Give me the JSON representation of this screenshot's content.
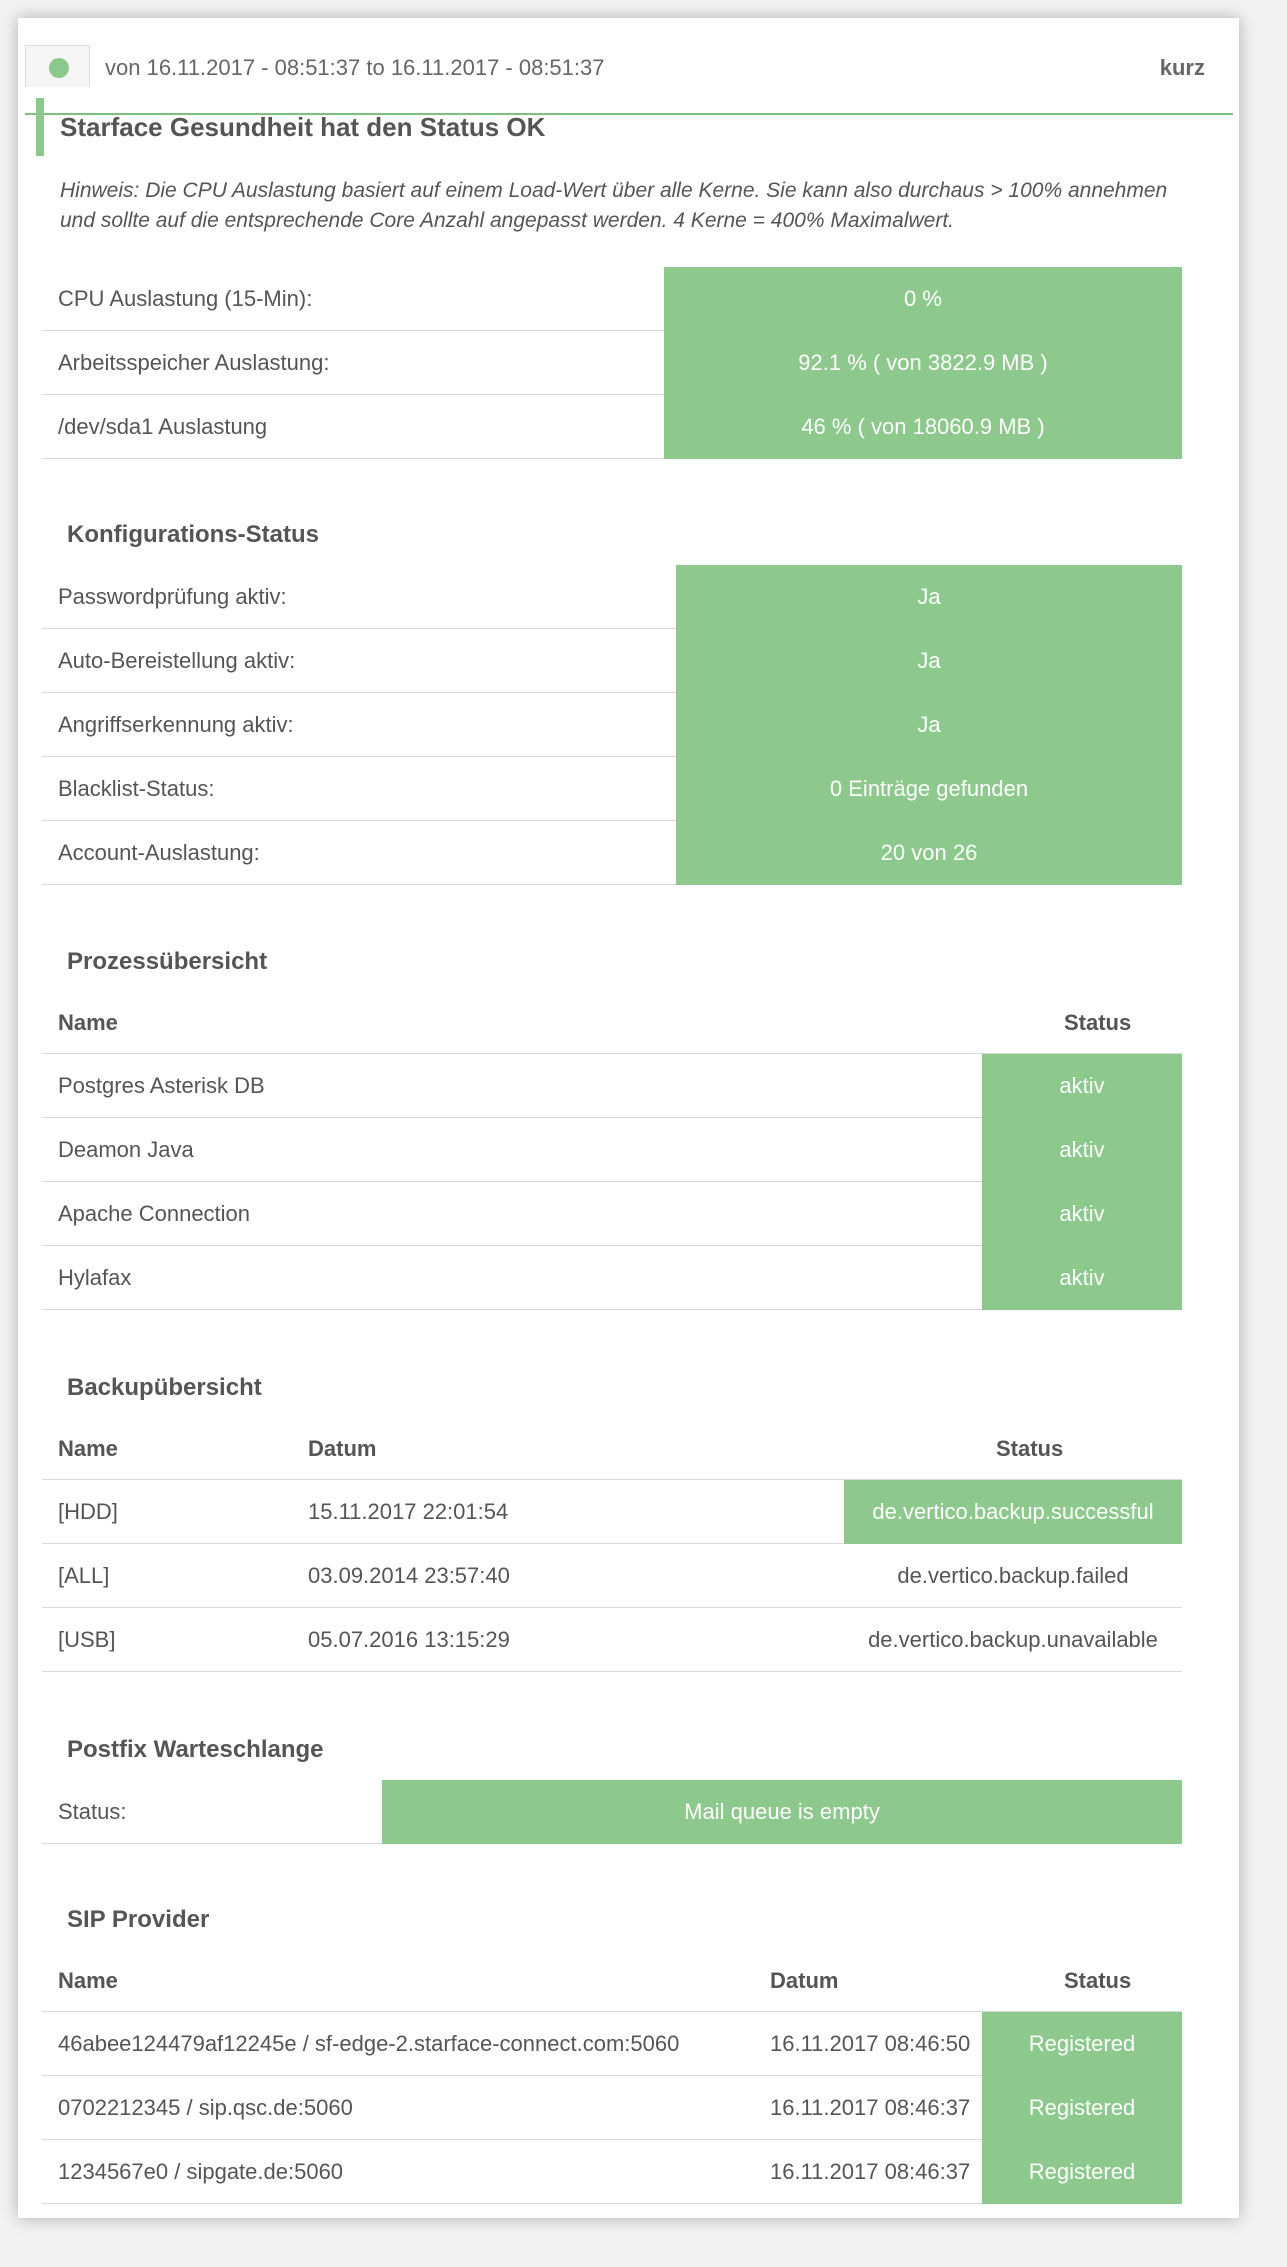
{
  "header": {
    "range": "von 16.11.2017 - 08:51:37 to 16.11.2017 - 08:51:37",
    "mode": "kurz",
    "status_color": "#8cc88c"
  },
  "health": {
    "title": "Starface Gesundheit hat den Status OK",
    "hint": "Hinweis: Die CPU Auslastung basiert auf einem Load-Wert über alle Kerne. Sie kann also durchaus > 100% annehmen und sollte auf die entsprechende Core Anzahl angepasst werden. 4 Kerne = 400% Maximalwert.",
    "rows": [
      {
        "label": "CPU Auslastung (15-Min):",
        "value": "0 %"
      },
      {
        "label": "Arbeitsspeicher Auslastung:",
        "value": "92.1 % ( von 3822.9 MB )"
      },
      {
        "label": "/dev/sda1 Auslastung",
        "value": "46 % ( von 18060.9 MB )"
      }
    ]
  },
  "config": {
    "title": "Konfigurations-Status",
    "rows": [
      {
        "label": "Passwordprüfung aktiv:",
        "value": "Ja"
      },
      {
        "label": "Auto-Bereistellung aktiv:",
        "value": "Ja"
      },
      {
        "label": "Angriffserkennung aktiv:",
        "value": "Ja"
      },
      {
        "label": "Blacklist-Status:",
        "value": "0 Einträge gefunden"
      },
      {
        "label": "Account-Auslastung:",
        "value": "20 von 26"
      }
    ]
  },
  "processes": {
    "title": "Prozessübersicht",
    "col_name": "Name",
    "col_status": "Status",
    "rows": [
      {
        "name": "Postgres Asterisk DB",
        "status": "aktiv"
      },
      {
        "name": "Deamon Java",
        "status": "aktiv"
      },
      {
        "name": "Apache Connection",
        "status": "aktiv"
      },
      {
        "name": "Hylafax",
        "status": "aktiv"
      }
    ]
  },
  "backups": {
    "title": "Backupübersicht",
    "col_name": "Name",
    "col_date": "Datum",
    "col_status": "Status",
    "rows": [
      {
        "name": "[HDD]",
        "date": "15.11.2017 22:01:54",
        "status": "de.vertico.backup.successful"
      },
      {
        "name": "[ALL]",
        "date": "03.09.2014 23:57:40",
        "status": "de.vertico.backup.failed"
      },
      {
        "name": "[USB]",
        "date": "05.07.2016 13:15:29",
        "status": "de.vertico.backup.unavailable"
      }
    ]
  },
  "postfix": {
    "title": "Postfix Warteschlange",
    "label": "Status:",
    "value": "Mail queue is empty"
  },
  "sip": {
    "title": "SIP Provider",
    "col_name": "Name",
    "col_date": "Datum",
    "col_status": "Status",
    "rows": [
      {
        "name": "46abee124479af12245e / sf-edge-2.starface-connect.com:5060",
        "date": "16.11.2017 08:46:50",
        "status": "Registered"
      },
      {
        "name": "0702212345 / sip.qsc.de:5060",
        "date": "16.11.2017 08:46:37",
        "status": "Registered"
      },
      {
        "name": "1234567e0 / sipgate.de:5060",
        "date": "16.11.2017 08:46:37",
        "status": "Registered"
      }
    ]
  }
}
